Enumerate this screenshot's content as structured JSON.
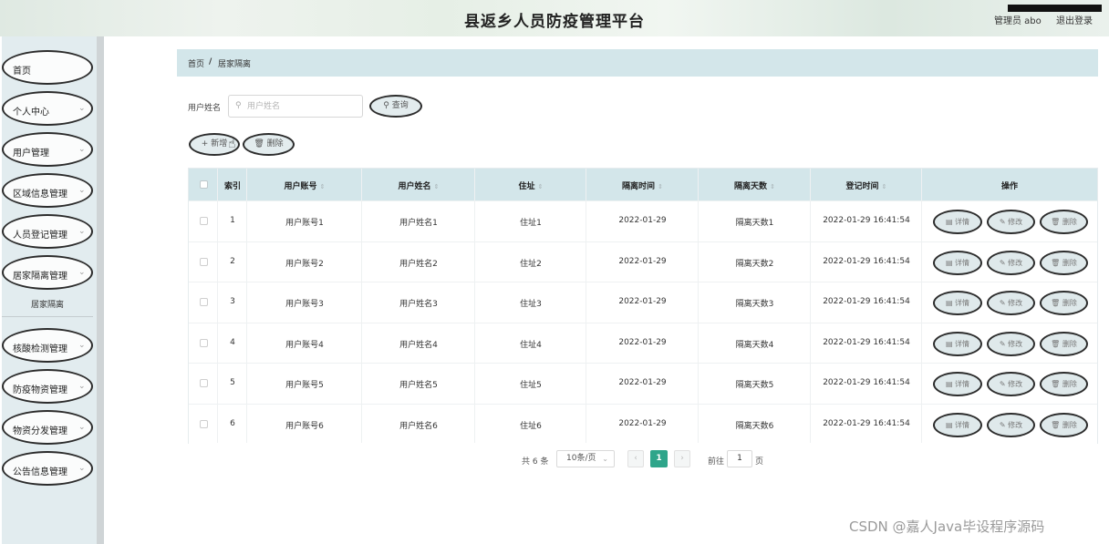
{
  "header": {
    "title": "县返乡人员防疫管理平台",
    "admin": "管理员 abo",
    "logout": "退出登录"
  },
  "sidebar": {
    "items": [
      {
        "label": "首页",
        "chev": ""
      },
      {
        "label": "个人中心",
        "chev": "⌄"
      },
      {
        "label": "用户管理",
        "chev": "⌄"
      },
      {
        "label": "区域信息管理",
        "chev": "⌄"
      },
      {
        "label": "人员登记管理",
        "chev": "⌄"
      },
      {
        "label": "居家隔离管理",
        "chev": "⌄"
      },
      {
        "label": "核酸检测管理",
        "chev": "⌄"
      },
      {
        "label": "防疫物资管理",
        "chev": "⌄"
      },
      {
        "label": "物资分发管理",
        "chev": "⌄"
      },
      {
        "label": "公告信息管理",
        "chev": "⌄"
      }
    ],
    "submenu": "居家隔离"
  },
  "breadcrumb": {
    "home": "首页",
    "sep": "/",
    "current": "居家隔离"
  },
  "search": {
    "label": "用户姓名",
    "placeholder": "用户姓名",
    "button": "查询"
  },
  "toolbar": {
    "add": "+ 新增",
    "delete": "删除"
  },
  "table": {
    "columns": [
      "索引",
      "用户账号",
      "用户姓名",
      "住址",
      "隔离时间",
      "隔离天数",
      "登记时间",
      "操作"
    ],
    "rows": [
      {
        "index": "1",
        "account": "用户账号1",
        "name": "用户姓名1",
        "address": "住址1",
        "iso_time": "2022-01-29",
        "iso_days": "隔离天数1",
        "reg_time": "2022-01-29 16:41:54"
      },
      {
        "index": "2",
        "account": "用户账号2",
        "name": "用户姓名2",
        "address": "住址2",
        "iso_time": "2022-01-29",
        "iso_days": "隔离天数2",
        "reg_time": "2022-01-29 16:41:54"
      },
      {
        "index": "3",
        "account": "用户账号3",
        "name": "用户姓名3",
        "address": "住址3",
        "iso_time": "2022-01-29",
        "iso_days": "隔离天数3",
        "reg_time": "2022-01-29 16:41:54"
      },
      {
        "index": "4",
        "account": "用户账号4",
        "name": "用户姓名4",
        "address": "住址4",
        "iso_time": "2022-01-29",
        "iso_days": "隔离天数4",
        "reg_time": "2022-01-29 16:41:54"
      },
      {
        "index": "5",
        "account": "用户账号5",
        "name": "用户姓名5",
        "address": "住址5",
        "iso_time": "2022-01-29",
        "iso_days": "隔离天数5",
        "reg_time": "2022-01-29 16:41:54"
      },
      {
        "index": "6",
        "account": "用户账号6",
        "name": "用户姓名6",
        "address": "住址6",
        "iso_time": "2022-01-29",
        "iso_days": "隔离天数6",
        "reg_time": "2022-01-29 16:41:54"
      }
    ],
    "actions": {
      "detail": "详情",
      "edit": "修改",
      "delete": "删除"
    }
  },
  "pagination": {
    "total": "共 6 条",
    "page_size": "10条/页",
    "current": "1",
    "goto_prefix": "前往",
    "goto_value": "1",
    "goto_suffix": "页"
  },
  "watermark": "CSDN @嘉人Java毕设程序源码",
  "colors": {
    "accent": "#2ea58a",
    "header_bg": "#d3e6ea",
    "sidebar_bg": "#e2ecef"
  },
  "icons": {
    "search": "search-icon",
    "delete": "trash-icon",
    "detail": "doc-icon",
    "edit": "pencil-icon"
  }
}
